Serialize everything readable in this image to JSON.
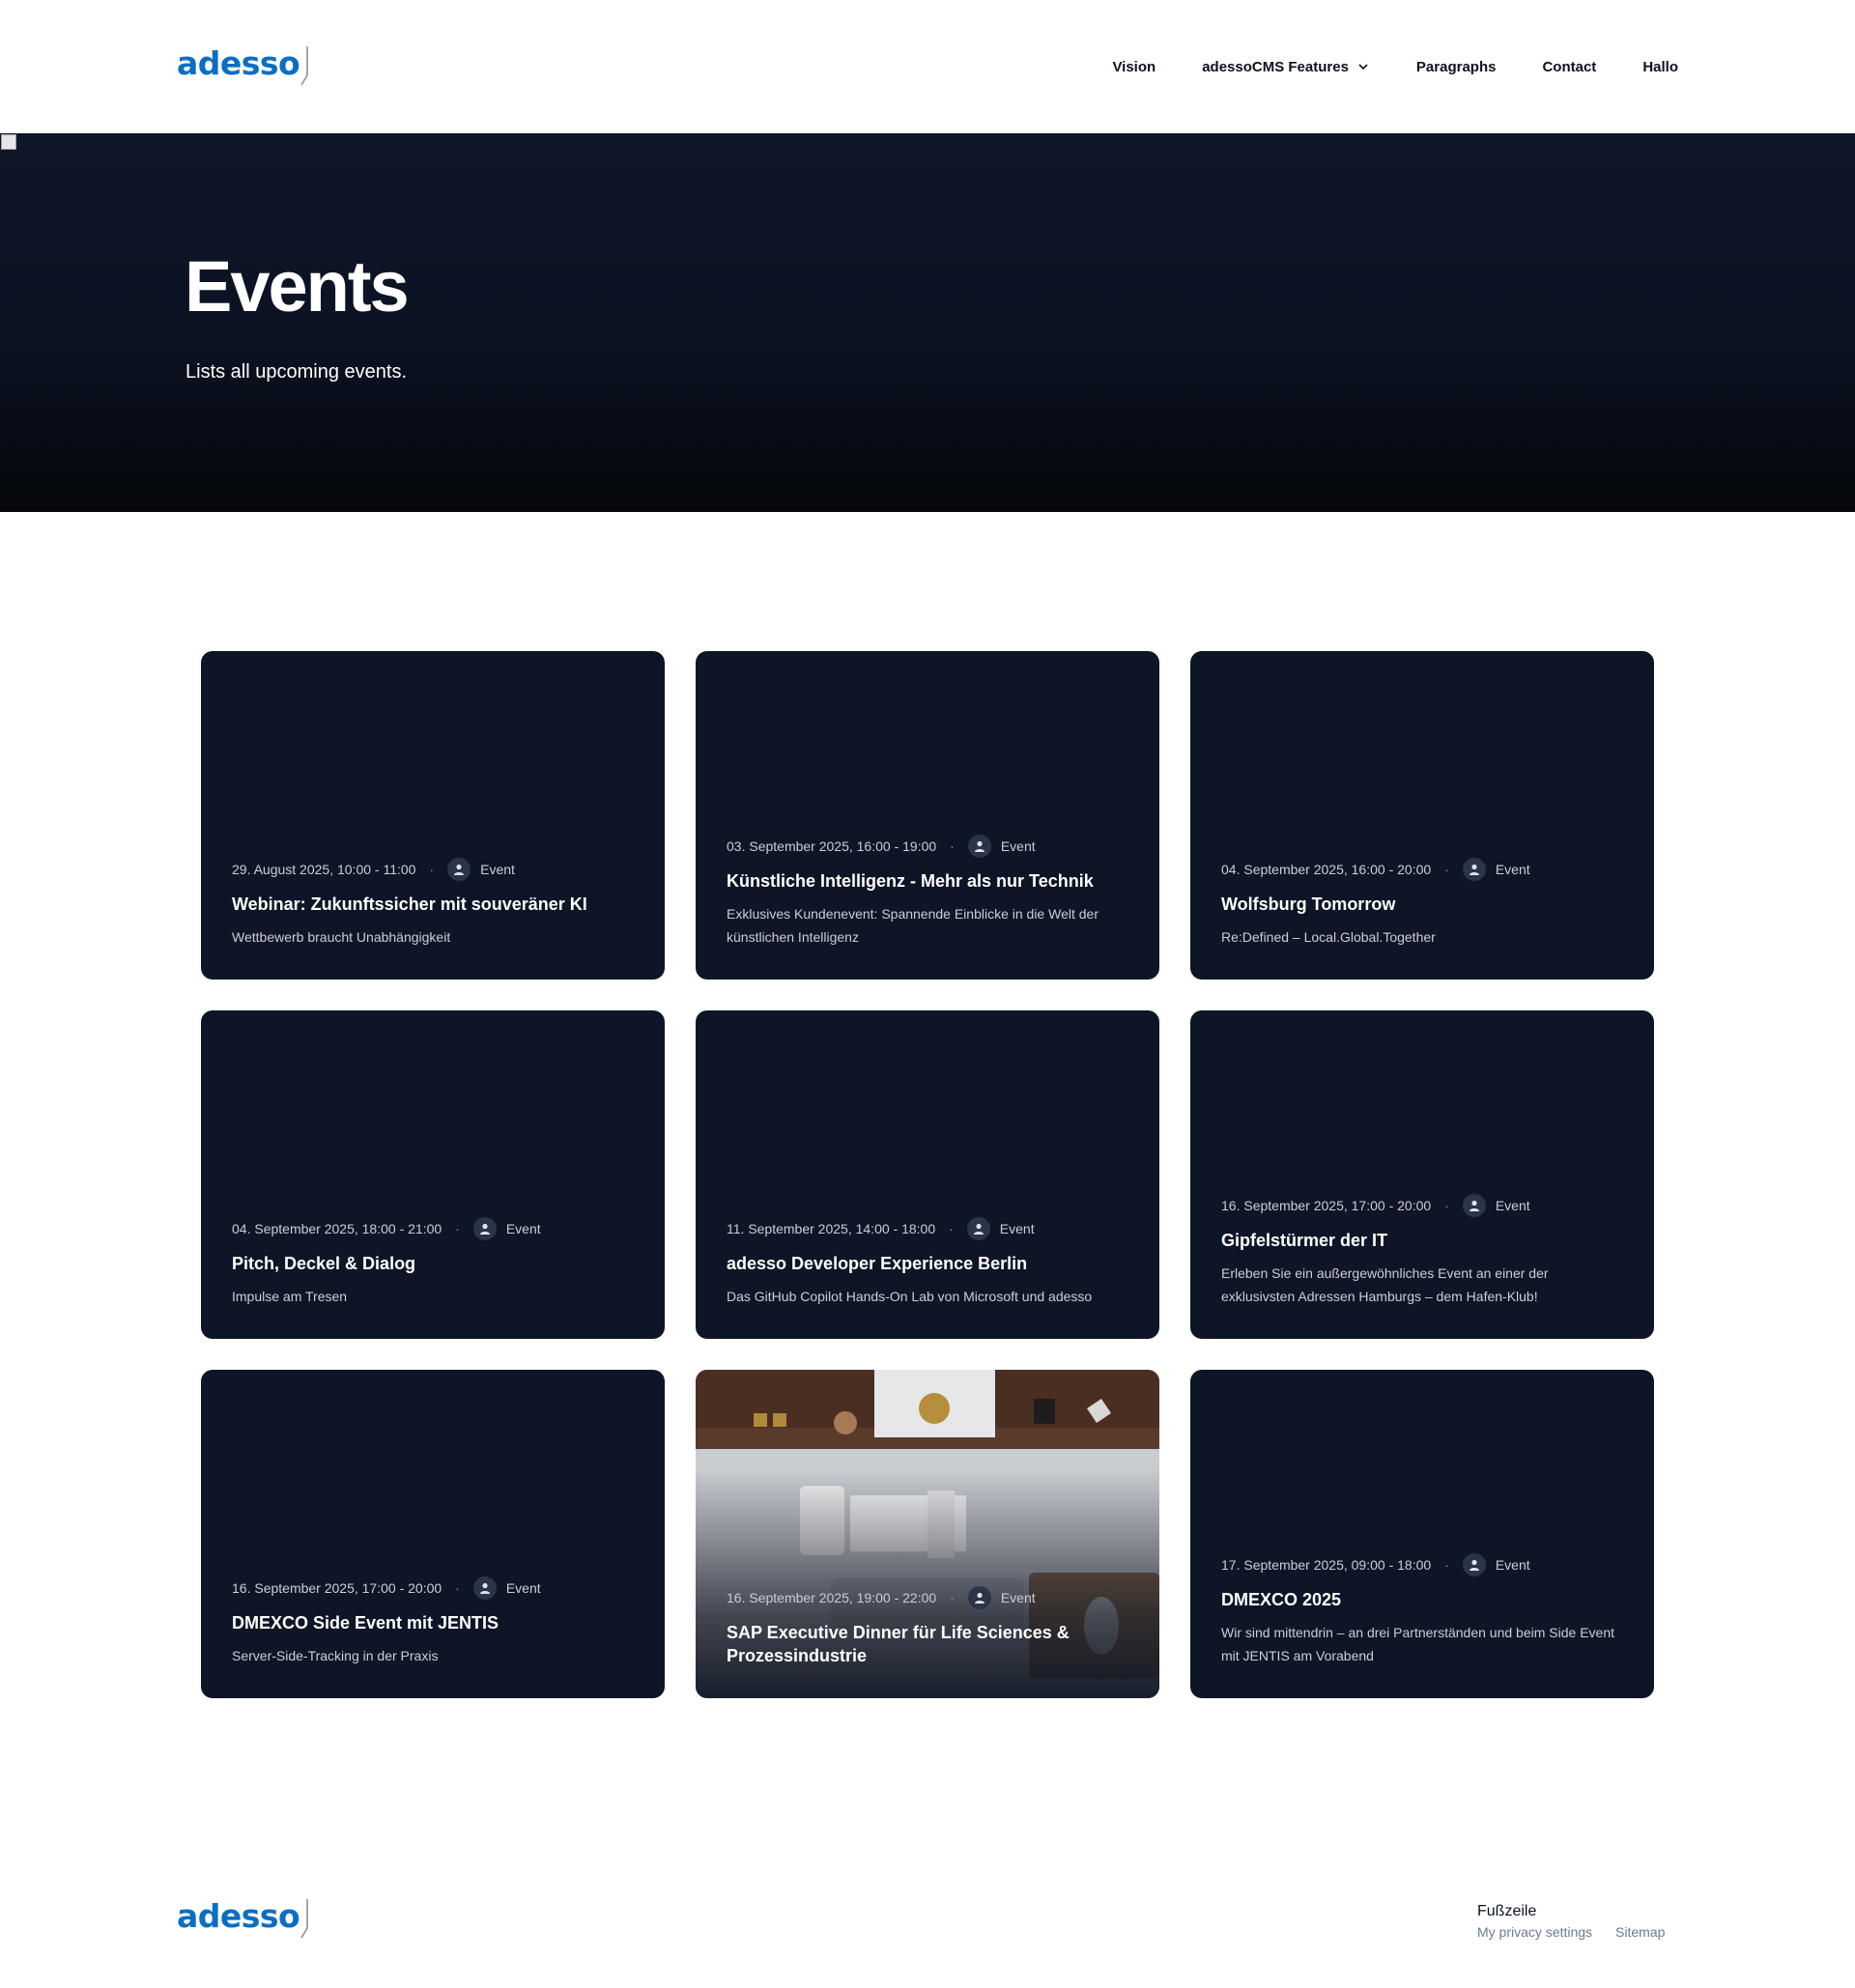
{
  "header": {
    "logo_text": "adesso",
    "nav": [
      {
        "label": "Vision"
      },
      {
        "label": "adessoCMS Features",
        "has_dropdown": true
      },
      {
        "label": "Paragraphs"
      },
      {
        "label": "Contact"
      },
      {
        "label": "Hallo"
      }
    ]
  },
  "hero": {
    "title": "Events",
    "subtitle": "Lists all upcoming events."
  },
  "events": [
    {
      "date": "29. August 2025, 10:00 - 11:00",
      "type": "Event",
      "title": "Webinar: Zukunftssicher mit souveräner KI",
      "description": "Wettbewerb braucht Unabhängigkeit"
    },
    {
      "date": "03. September 2025, 16:00 - 19:00",
      "type": "Event",
      "title": "Künstliche Intelligenz - Mehr als nur Technik",
      "description": "Exklusives Kundenevent: Spannende Einblicke in die Welt der künstlichen Intelligenz"
    },
    {
      "date": "04. September 2025, 16:00 - 20:00",
      "type": "Event",
      "title": "Wolfsburg Tomorrow",
      "description": "Re:Defined – Local.Global.Together"
    },
    {
      "date": "04. September 2025, 18:00 - 21:00",
      "type": "Event",
      "title": "Pitch, Deckel & Dialog",
      "description": "Impulse am Tresen"
    },
    {
      "date": "11. September 2025, 14:00 - 18:00",
      "type": "Event",
      "title": "adesso Developer Experience Berlin",
      "description": "Das GitHub Copilot Hands-On Lab von Microsoft und adesso"
    },
    {
      "date": "16. September 2025, 17:00 - 20:00",
      "type": "Event",
      "title": "Gipfelstürmer der IT",
      "description": "Erleben Sie ein außergewöhnliches Event an einer der exklusivsten Adressen Hamburgs – dem Hafen-Klub!"
    },
    {
      "date": "16. September 2025, 17:00 - 20:00",
      "type": "Event",
      "title": "DMEXCO Side Event mit JENTIS",
      "description": "Server-Side-Tracking in der Praxis"
    },
    {
      "date": "16. September 2025, 19:00 - 22:00",
      "type": "Event",
      "title": "SAP Executive Dinner für Life Sciences & Prozessindustrie",
      "description": "",
      "has_image": true
    },
    {
      "date": "17. September 2025, 09:00 - 18:00",
      "type": "Event",
      "title": "DMEXCO 2025",
      "description": "Wir sind mittendrin – an drei Partnerständen und beim Side Event mit JENTIS am Vorabend"
    }
  ],
  "footer": {
    "logo_text": "adesso",
    "title": "Fußzeile",
    "links": [
      "My privacy settings",
      "Sitemap"
    ]
  },
  "colors": {
    "brand_blue": "#0a6ec3",
    "card_bg": "#0e1526",
    "hero_bg": "#0b1222"
  }
}
